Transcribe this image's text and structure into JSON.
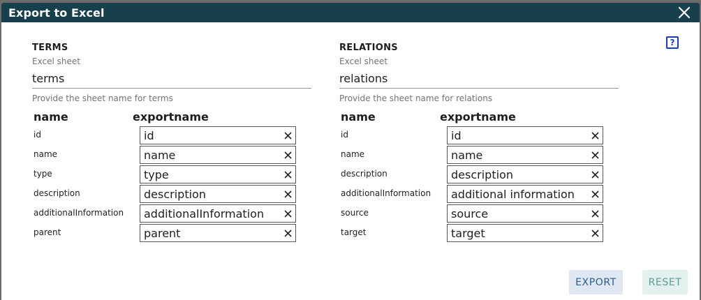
{
  "dialog": {
    "title": "Export to Excel",
    "help_symbol": "?"
  },
  "terms": {
    "title": "TERMS",
    "sheet_label": "Excel sheet",
    "sheet_value": "terms",
    "sheet_help": "Provide the sheet name for terms",
    "col_name": "name",
    "col_export": "exportname",
    "rows": [
      {
        "name": "id",
        "export": "id"
      },
      {
        "name": "name",
        "export": "name"
      },
      {
        "name": "type",
        "export": "type"
      },
      {
        "name": "description",
        "export": "description"
      },
      {
        "name": "additionalInformation",
        "export": "additionalInformation"
      },
      {
        "name": "parent",
        "export": "parent"
      }
    ]
  },
  "relations": {
    "title": "RELATIONS",
    "sheet_label": "Excel sheet",
    "sheet_value": "relations",
    "sheet_help": "Provide the sheet name for relations",
    "col_name": "name",
    "col_export": "exportname",
    "rows": [
      {
        "name": "id",
        "export": "id"
      },
      {
        "name": "name",
        "export": "name"
      },
      {
        "name": "description",
        "export": "description"
      },
      {
        "name": "additionalInformation",
        "export": "additional information"
      },
      {
        "name": "source",
        "export": "source"
      },
      {
        "name": "target",
        "export": "target"
      }
    ]
  },
  "actions": {
    "export_label": "EXPORT",
    "reset_label": "RESET"
  },
  "colors": {
    "titlebar": "#173f4c",
    "help": "#1a3fb0",
    "export_bg": "#dfe8f2",
    "reset_bg": "#e2f0ee"
  },
  "icons": {
    "close": "close-icon",
    "clear": "clear-icon",
    "help": "help-icon"
  }
}
